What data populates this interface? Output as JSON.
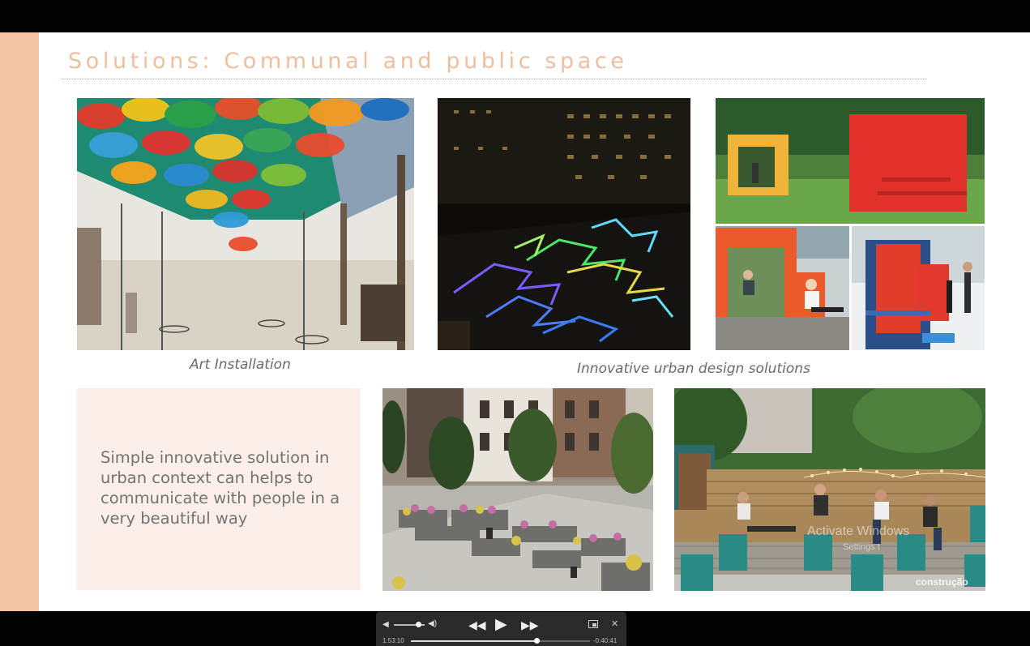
{
  "slide": {
    "title": "Solutions: Communal and public space",
    "captions": {
      "art": "Art Installation",
      "urban": "Innovative urban design solutions"
    },
    "body_text": "Simple innovative solution in urban context can helps to communicate with people in a very beautiful way",
    "watermark_title": "Activate Windows",
    "watermark_sub": "Settings t",
    "logo_text": "construção"
  },
  "player": {
    "elapsed": "1:53:10",
    "remaining": "-0:40:41",
    "progress": 0.7,
    "volume": 0.8,
    "icons": [
      "volume-low-icon",
      "volume-high-icon",
      "rewind-icon",
      "play-icon",
      "fast-forward-icon",
      "picture-in-picture-icon",
      "collapse-icon"
    ]
  },
  "colors": {
    "accent": "#f4c4a6",
    "title": "#eebf9f",
    "textbox_bg": "#fcefea"
  }
}
